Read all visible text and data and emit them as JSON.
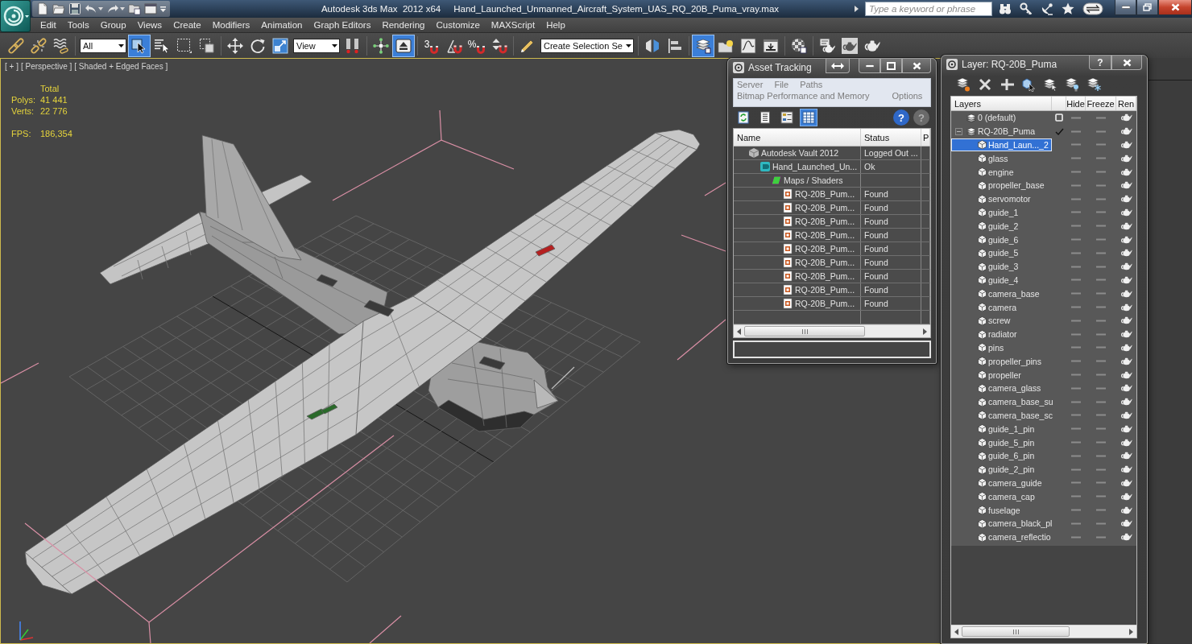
{
  "titlebar": {
    "app_title": "Autodesk 3ds Max  2012 x64",
    "file_name": "Hand_Launched_Unmanned_Aircraft_System_UAS_RQ_20B_Puma_vray.max",
    "search": {
      "placeholder": "Type a keyword or phrase"
    }
  },
  "menu": [
    "Edit",
    "Tools",
    "Group",
    "Views",
    "Create",
    "Modifiers",
    "Animation",
    "Graph Editors",
    "Rendering",
    "Customize",
    "MAXScript",
    "Help"
  ],
  "toolbar": [
    {
      "kind": "link",
      "selected": false
    },
    {
      "kind": "unlink",
      "selected": false
    },
    {
      "kind": "bind",
      "selected": false
    },
    {
      "kind": "separator"
    },
    {
      "kind": "dropdown",
      "value": "All"
    },
    {
      "kind": "select",
      "selected": true
    },
    {
      "kind": "select-by-name",
      "selected": false
    },
    {
      "kind": "region",
      "selected": false
    },
    {
      "kind": "crossing",
      "selected": false
    },
    {
      "kind": "separator"
    },
    {
      "kind": "move",
      "selected": false
    },
    {
      "kind": "rotate",
      "selected": false
    },
    {
      "kind": "scale",
      "selected": false
    },
    {
      "kind": "dropdown",
      "value": "View"
    },
    {
      "kind": "pivot",
      "selected": false
    },
    {
      "kind": "separator"
    },
    {
      "kind": "manipulate",
      "selected": false
    },
    {
      "kind": "shortcut",
      "selected": true
    },
    {
      "kind": "separator"
    },
    {
      "kind": "snap",
      "label": "3",
      "selected": false
    },
    {
      "kind": "angle-snap",
      "selected": false
    },
    {
      "kind": "percent-snap",
      "label": "%",
      "selected": false
    },
    {
      "kind": "spinner-snap",
      "selected": false
    },
    {
      "kind": "separator"
    },
    {
      "kind": "named-sets",
      "selected": false
    },
    {
      "kind": "dropdown",
      "value": "Create Selection Se"
    },
    {
      "kind": "separator"
    },
    {
      "kind": "mirror",
      "selected": false
    },
    {
      "kind": "align",
      "selected": false
    },
    {
      "kind": "separator"
    },
    {
      "kind": "layers",
      "selected": true
    },
    {
      "kind": "ribbon",
      "selected": false
    },
    {
      "kind": "curve-editor",
      "selected": false
    },
    {
      "kind": "schematic",
      "selected": false
    },
    {
      "kind": "separator"
    },
    {
      "kind": "material-editor",
      "selected": false
    },
    {
      "kind": "separator"
    },
    {
      "kind": "render-setup",
      "selected": false
    },
    {
      "kind": "frame-window",
      "selected": false
    },
    {
      "kind": "render",
      "selected": false
    }
  ],
  "viewport": {
    "active": true,
    "labels": [
      "[ + ]",
      "[ Perspective ]",
      "[ Shaded + Edged Faces ]"
    ],
    "stats": {
      "heading": "Total",
      "counts": [
        {
          "label": "Polys:",
          "value": "41 441"
        },
        {
          "label": "Verts:",
          "value": "22 776"
        }
      ],
      "fps": {
        "label": "FPS:",
        "value": "186,354"
      }
    }
  },
  "asset_tracking": {
    "title": "Asset Tracking",
    "menu_rows": [
      [
        "Server",
        "File",
        "Paths"
      ],
      [
        "Bitmap Performance and Memory",
        "Options"
      ]
    ],
    "view_buttons": [
      {
        "kind": "refresh",
        "selected": false
      },
      {
        "kind": "list",
        "selected": false
      },
      {
        "kind": "thumbnails",
        "selected": false
      },
      {
        "kind": "table",
        "selected": true
      }
    ],
    "help_buttons": [
      {
        "label": "?",
        "disabled": false
      },
      {
        "label": "?",
        "disabled": true
      }
    ],
    "columns": [
      "Name",
      "Status",
      "P"
    ],
    "assets": [
      {
        "name": "Autodesk Vault 2012",
        "status": "Logged Out ...",
        "kind": "vault",
        "children": [
          {
            "name": "Hand_Launched_Un...",
            "status": "Ok",
            "kind": "scene",
            "children": [
              {
                "name": "Maps / Shaders",
                "kind": "folder",
                "children": [
                  {
                    "name": "RQ-20B_Pum...",
                    "status": "Found",
                    "kind": "bitmap"
                  },
                  {
                    "name": "RQ-20B_Pum...",
                    "status": "Found",
                    "kind": "bitmap"
                  },
                  {
                    "name": "RQ-20B_Pum...",
                    "status": "Found",
                    "kind": "bitmap"
                  },
                  {
                    "name": "RQ-20B_Pum...",
                    "status": "Found",
                    "kind": "bitmap"
                  },
                  {
                    "name": "RQ-20B_Pum...",
                    "status": "Found",
                    "kind": "bitmap"
                  },
                  {
                    "name": "RQ-20B_Pum...",
                    "status": "Found",
                    "kind": "bitmap"
                  },
                  {
                    "name": "RQ-20B_Pum...",
                    "status": "Found",
                    "kind": "bitmap"
                  },
                  {
                    "name": "RQ-20B_Pum...",
                    "status": "Found",
                    "kind": "bitmap"
                  },
                  {
                    "name": "RQ-20B_Pum...",
                    "status": "Found",
                    "kind": "bitmap"
                  }
                ]
              }
            ]
          }
        ]
      }
    ]
  },
  "layer_manager": {
    "title": "Layer: RQ-20B_Puma",
    "help_button": "?",
    "columns": [
      "Layers",
      "Hide",
      "Freeze",
      "Ren"
    ],
    "layers": [
      {
        "name": "0 (default)",
        "kind": "layer",
        "current": false,
        "selected": false,
        "hidden": false,
        "frozen": false,
        "renderable": true
      },
      {
        "name": "RQ-20B_Puma",
        "kind": "layer",
        "current": true,
        "expanded": true,
        "selected": false,
        "hidden": false,
        "frozen": false,
        "renderable": true,
        "children": [
          {
            "name": "Hand_Laun..._2",
            "kind": "object",
            "selected": true,
            "hidden": false,
            "frozen": false,
            "renderable": true
          },
          {
            "name": "glass",
            "kind": "object",
            "selected": false,
            "hidden": false,
            "frozen": false,
            "renderable": true
          },
          {
            "name": "engine",
            "kind": "object",
            "selected": false,
            "hidden": false,
            "frozen": false,
            "renderable": true
          },
          {
            "name": "propeller_base",
            "kind": "object",
            "selected": false,
            "hidden": false,
            "frozen": false,
            "renderable": true
          },
          {
            "name": "servomotor",
            "kind": "object",
            "selected": false,
            "hidden": false,
            "frozen": false,
            "renderable": true
          },
          {
            "name": "guide_1",
            "kind": "object",
            "selected": false,
            "hidden": false,
            "frozen": false,
            "renderable": true
          },
          {
            "name": "guide_2",
            "kind": "object",
            "selected": false,
            "hidden": false,
            "frozen": false,
            "renderable": true
          },
          {
            "name": "guide_6",
            "kind": "object",
            "selected": false,
            "hidden": false,
            "frozen": false,
            "renderable": true
          },
          {
            "name": "guide_5",
            "kind": "object",
            "selected": false,
            "hidden": false,
            "frozen": false,
            "renderable": true
          },
          {
            "name": "guide_3",
            "kind": "object",
            "selected": false,
            "hidden": false,
            "frozen": false,
            "renderable": true
          },
          {
            "name": "guide_4",
            "kind": "object",
            "selected": false,
            "hidden": false,
            "frozen": false,
            "renderable": true
          },
          {
            "name": "camera_base",
            "kind": "object",
            "selected": false,
            "hidden": false,
            "frozen": false,
            "renderable": true
          },
          {
            "name": "camera",
            "kind": "object",
            "selected": false,
            "hidden": false,
            "frozen": false,
            "renderable": true
          },
          {
            "name": "screw",
            "kind": "object",
            "selected": false,
            "hidden": false,
            "frozen": false,
            "renderable": true
          },
          {
            "name": "radiator",
            "kind": "object",
            "selected": false,
            "hidden": false,
            "frozen": false,
            "renderable": true
          },
          {
            "name": "pins",
            "kind": "object",
            "selected": false,
            "hidden": false,
            "frozen": false,
            "renderable": true
          },
          {
            "name": "propeller_pins",
            "kind": "object",
            "selected": false,
            "hidden": false,
            "frozen": false,
            "renderable": true
          },
          {
            "name": "propeller",
            "kind": "object",
            "selected": false,
            "hidden": false,
            "frozen": false,
            "renderable": true
          },
          {
            "name": "camera_glass",
            "kind": "object",
            "selected": false,
            "hidden": false,
            "frozen": false,
            "renderable": true
          },
          {
            "name": "camera_base_su",
            "kind": "object",
            "selected": false,
            "hidden": false,
            "frozen": false,
            "renderable": true
          },
          {
            "name": "camera_base_sc",
            "kind": "object",
            "selected": false,
            "hidden": false,
            "frozen": false,
            "renderable": true
          },
          {
            "name": "guide_1_pin",
            "kind": "object",
            "selected": false,
            "hidden": false,
            "frozen": false,
            "renderable": true
          },
          {
            "name": "guide_5_pin",
            "kind": "object",
            "selected": false,
            "hidden": false,
            "frozen": false,
            "renderable": true
          },
          {
            "name": "guide_6_pin",
            "kind": "object",
            "selected": false,
            "hidden": false,
            "frozen": false,
            "renderable": true
          },
          {
            "name": "guide_2_pin",
            "kind": "object",
            "selected": false,
            "hidden": false,
            "frozen": false,
            "renderable": true
          },
          {
            "name": "camera_guide",
            "kind": "object",
            "selected": false,
            "hidden": false,
            "frozen": false,
            "renderable": true
          },
          {
            "name": "camera_cap",
            "kind": "object",
            "selected": false,
            "hidden": false,
            "frozen": false,
            "renderable": true
          },
          {
            "name": "fuselage",
            "kind": "object",
            "selected": false,
            "hidden": false,
            "frozen": false,
            "renderable": true
          },
          {
            "name": "camera_black_pl",
            "kind": "object",
            "selected": false,
            "hidden": false,
            "frozen": false,
            "renderable": true
          },
          {
            "name": "camera_reflectio",
            "kind": "object",
            "selected": false,
            "hidden": false,
            "frozen": false,
            "renderable": true
          }
        ]
      }
    ]
  }
}
